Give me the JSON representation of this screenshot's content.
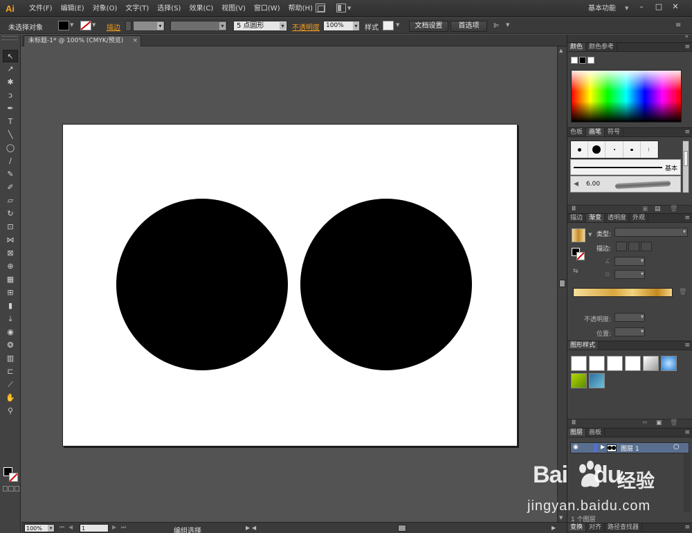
{
  "app": {
    "logo": "Ai"
  },
  "menu": {
    "items": [
      "文件(F)",
      "编辑(E)",
      "对象(O)",
      "文字(T)",
      "选择(S)",
      "效果(C)",
      "视图(V)",
      "窗口(W)",
      "帮助(H)"
    ],
    "workspace": "基本功能"
  },
  "window_controls": {
    "minimize": "–",
    "maximize": "□",
    "close": "✕"
  },
  "control_bar": {
    "selection_status": "未选择对象",
    "fill_color": "#000000",
    "stroke_label": "描边",
    "brush_value": "5 点圆形",
    "opacity_label": "不透明度",
    "opacity_value": "100%",
    "style_label": "样式",
    "doc_setup_button": "文档设置",
    "prefs_button": "首选项"
  },
  "tools": [
    {
      "name": "selection-tool",
      "glyph": "↖"
    },
    {
      "name": "direct-selection-tool",
      "glyph": "↗"
    },
    {
      "name": "magic-wand-tool",
      "glyph": "✱"
    },
    {
      "name": "lasso-tool",
      "glyph": "ↄ"
    },
    {
      "name": "pen-tool",
      "glyph": "✒"
    },
    {
      "name": "type-tool",
      "glyph": "T"
    },
    {
      "name": "line-tool",
      "glyph": "╲"
    },
    {
      "name": "ellipse-tool",
      "glyph": "◯"
    },
    {
      "name": "paintbrush-tool",
      "glyph": "∕"
    },
    {
      "name": "pencil-tool",
      "glyph": "✎"
    },
    {
      "name": "blob-brush-tool",
      "glyph": "✐"
    },
    {
      "name": "eraser-tool",
      "glyph": "▱"
    },
    {
      "name": "rotate-tool",
      "glyph": "↻"
    },
    {
      "name": "scale-tool",
      "glyph": "⊡"
    },
    {
      "name": "width-tool",
      "glyph": "⋈"
    },
    {
      "name": "free-transform-tool",
      "glyph": "⊠"
    },
    {
      "name": "shape-builder-tool",
      "glyph": "⊕"
    },
    {
      "name": "perspective-grid-tool",
      "glyph": "▦"
    },
    {
      "name": "mesh-tool",
      "glyph": "⊞"
    },
    {
      "name": "gradient-tool",
      "glyph": "▮"
    },
    {
      "name": "eyedropper-tool",
      "glyph": "⤓"
    },
    {
      "name": "blend-tool",
      "glyph": "◉"
    },
    {
      "name": "symbol-sprayer-tool",
      "glyph": "❂"
    },
    {
      "name": "column-graph-tool",
      "glyph": "▥"
    },
    {
      "name": "artboard-tool",
      "glyph": "⊏"
    },
    {
      "name": "slice-tool",
      "glyph": "⟋"
    },
    {
      "name": "hand-tool",
      "glyph": "✋"
    },
    {
      "name": "zoom-tool",
      "glyph": "⚲"
    }
  ],
  "document": {
    "tab_title": "未标题-1* @ 100% (CMYK/预览)",
    "tab_close": "×"
  },
  "status_bar": {
    "zoom": "100%",
    "page": "1",
    "current_tool": "编组选择"
  },
  "panels": {
    "color": {
      "tabs": [
        "颜色",
        "颜色参考"
      ]
    },
    "brushes": {
      "tabs": [
        "色板",
        "画笔",
        "符号"
      ],
      "basic_label": "基本",
      "art_brush_size": "6.00"
    },
    "gradient": {
      "tabs": [
        "描边",
        "渐变",
        "透明度",
        "外观"
      ],
      "type_label": "类型:",
      "stroke_label": "描边:",
      "opacity_label": "不透明度:",
      "location_label": "位置:"
    },
    "graphic_styles": {
      "tabs": [
        "图形样式"
      ]
    },
    "layers": {
      "tabs": [
        "图层",
        "画板"
      ],
      "layer_name": "图层 1",
      "layer_count": "1 个图层"
    },
    "bottom": {
      "tabs": [
        "变换",
        "对齐",
        "路径查找器"
      ]
    }
  },
  "artwork": {
    "circles": [
      {
        "name": "left-circle",
        "color": "#000000"
      },
      {
        "name": "right-circle",
        "color": "#000000"
      }
    ]
  },
  "watermark": {
    "brand": "Bai",
    "brand_tail": "du",
    "cn": "经验",
    "url": "jingyan.baidu.com"
  }
}
